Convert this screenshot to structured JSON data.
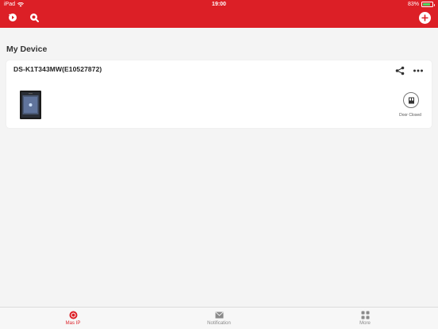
{
  "status_bar": {
    "device": "iPad",
    "time": "19:00",
    "battery": "83%",
    "battery_level": 0.83
  },
  "header": {
    "playback_icon": "playback-icon",
    "search_icon": "search-icon",
    "add_icon": "plus-icon"
  },
  "section": {
    "title": "My Device"
  },
  "device": {
    "name": "DS-K1T343MW(E10527872)",
    "share_icon": "share-icon",
    "more_icon": "more-dots-icon",
    "door_icon": "door-icon",
    "door_status": "Door Closed"
  },
  "tabs": [
    {
      "label": "Mas IP",
      "icon": "record-icon",
      "active": true
    },
    {
      "label": "Notification",
      "icon": "envelope-icon",
      "active": false
    },
    {
      "label": "More",
      "icon": "grid-icon",
      "active": false
    }
  ],
  "colors": {
    "brand": "#dc1f26",
    "battery": "#4cd964"
  }
}
